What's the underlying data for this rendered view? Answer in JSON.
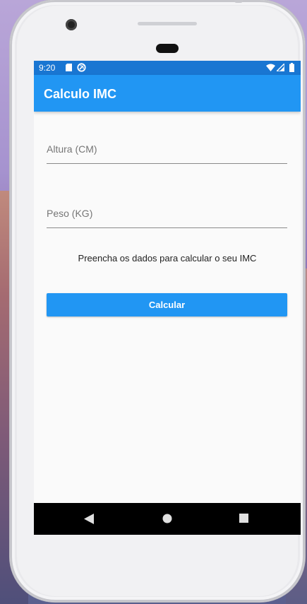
{
  "status_bar": {
    "time": "9:20",
    "icons": [
      "sd-card-icon",
      "sync-icon",
      "wifi-icon",
      "cell-signal-icon",
      "battery-icon"
    ]
  },
  "app_bar": {
    "title": "Calculo IMC"
  },
  "form": {
    "height_field": {
      "placeholder": "Altura (CM)",
      "value": ""
    },
    "weight_field": {
      "placeholder": "Peso (KG)",
      "value": ""
    },
    "info_text": "Preencha os dados para calcular o seu IMC",
    "calculate_button_label": "Calcular"
  },
  "nav_bar": {
    "icons": [
      "back-icon",
      "home-icon",
      "recents-icon"
    ]
  },
  "colors": {
    "status_bar": "#1976d2",
    "app_bar": "#2196f3",
    "button": "#2196f3",
    "screen_background": "#fafafa",
    "nav_bar": "#000000"
  }
}
